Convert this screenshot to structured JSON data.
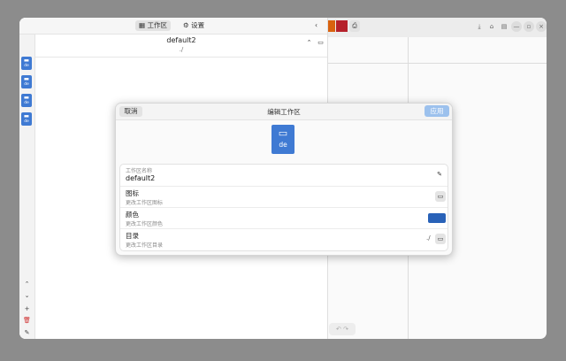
{
  "sidebar": {
    "tabs": [
      {
        "label": "工作区",
        "icon": "workspace-icon"
      },
      {
        "label": "设置",
        "icon": "gear-icon"
      }
    ],
    "collapse_icon": "‹",
    "workspaces_count": 4,
    "strip_buttons": [
      {
        "name": "move-up-button",
        "glyph": "⌃"
      },
      {
        "name": "move-down-button",
        "glyph": "⌄"
      },
      {
        "name": "add-workspace-button",
        "glyph": "+"
      },
      {
        "name": "delete-workspace-button",
        "glyph": "🗑"
      },
      {
        "name": "edit-workspace-button",
        "glyph": "✎"
      }
    ],
    "sheet": {
      "title": "default2",
      "path": "./"
    }
  },
  "background_window": {
    "title_icons": [
      "⤓",
      "⌂",
      "▤",
      "—",
      "▫",
      "×"
    ],
    "swatch_colors": [
      "#d9620f",
      "#b5212b"
    ],
    "undo_redo": "↶ ↷"
  },
  "dialog": {
    "cancel_label": "取消",
    "title": "编辑工作区",
    "apply_label": "应用",
    "preview_label": "de",
    "name_field": {
      "label": "工作区名称",
      "value": "default2"
    },
    "icon_row": {
      "label": "图标",
      "sub": "更改工作区图标"
    },
    "color_row": {
      "label": "颜色",
      "sub": "更改工作区颜色",
      "color": "#2962b8"
    },
    "dir_row": {
      "label": "目录",
      "sub": "更改工作区目录",
      "value": "./"
    }
  }
}
